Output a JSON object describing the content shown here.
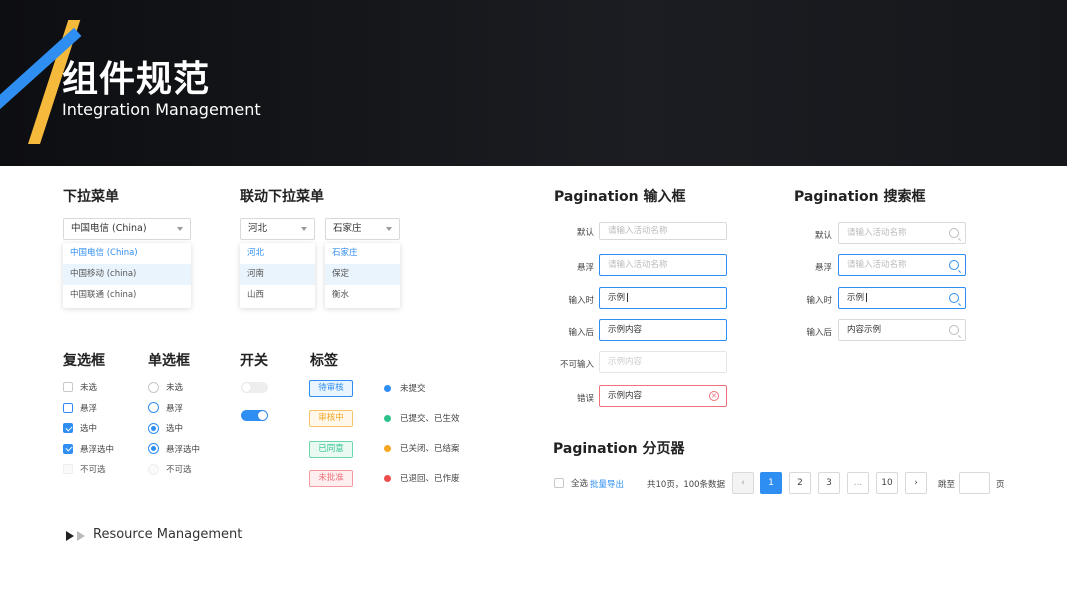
{
  "header": {
    "title": "组件规范",
    "subtitle": "Integration Management"
  },
  "colors": {
    "accent": "#2f8ef1",
    "logo_yellow": "#f5b93c",
    "header_bg": "#15171b"
  },
  "dropdown": {
    "title": "下拉菜单",
    "selected": "中国电信 (China)",
    "options": [
      "中国电信 (China)",
      "中国移动 (china)",
      "中国联通 (china)"
    ]
  },
  "cascade": {
    "title": "联动下拉菜单",
    "left_selected": "河北",
    "left_options": [
      "河北",
      "河南",
      "山西"
    ],
    "right_selected": "石家庄",
    "right_options": [
      "石家庄",
      "保定",
      "衡水"
    ]
  },
  "checkbox": {
    "title": "复选框",
    "items": [
      "未选",
      "悬浮",
      "选中",
      "悬浮选中",
      "不可选"
    ]
  },
  "radio": {
    "title": "单选框",
    "items": [
      "未选",
      "悬浮",
      "选中",
      "悬浮选中",
      "不可选"
    ]
  },
  "switch": {
    "title": "开关"
  },
  "tags": {
    "title": "标签",
    "items": [
      {
        "label": "待审核",
        "color": "#2f8ef1"
      },
      {
        "label": "审核中",
        "color": "#f5a623"
      },
      {
        "label": "已同意",
        "color": "#2cc38a"
      },
      {
        "label": "未批准",
        "color": "#f0727a"
      }
    ],
    "statuses": [
      {
        "label": "未提交",
        "color": "#2f8ef1"
      },
      {
        "label": "已提交、已生效",
        "color": "#2cc38a"
      },
      {
        "label": "已关闭、已结案",
        "color": "#f5a623"
      },
      {
        "label": "已退回、已作废",
        "color": "#ef4d4d"
      }
    ]
  },
  "pagination_input": {
    "title": "Pagination 输入框",
    "rows": [
      {
        "label": "默认",
        "value": "请输入活动名称"
      },
      {
        "label": "悬浮",
        "value": "请输入活动名称"
      },
      {
        "label": "输入时",
        "value": "示例"
      },
      {
        "label": "输入后",
        "value": "示例内容"
      },
      {
        "label": "不可输入",
        "value": "示例内容"
      },
      {
        "label": "错误",
        "value": "示例内容"
      }
    ]
  },
  "pagination_search": {
    "title": "Pagination 搜索框",
    "rows": [
      {
        "label": "默认",
        "value": "请输入活动名称"
      },
      {
        "label": "悬浮",
        "value": "请输入活动名称"
      },
      {
        "label": "输入时",
        "value": "示例"
      },
      {
        "label": "输入后",
        "value": "内容示例"
      }
    ]
  },
  "pager": {
    "title": "Pagination 分页器",
    "select_all": "全选",
    "bulk_export": "批量导出",
    "summary": "共10页，100条数据",
    "pages": [
      "1",
      "2",
      "3",
      "...",
      "10"
    ],
    "current": "1",
    "jump_label": "跳至",
    "page_suffix": "页"
  },
  "footer": {
    "label": "Resource Management"
  }
}
